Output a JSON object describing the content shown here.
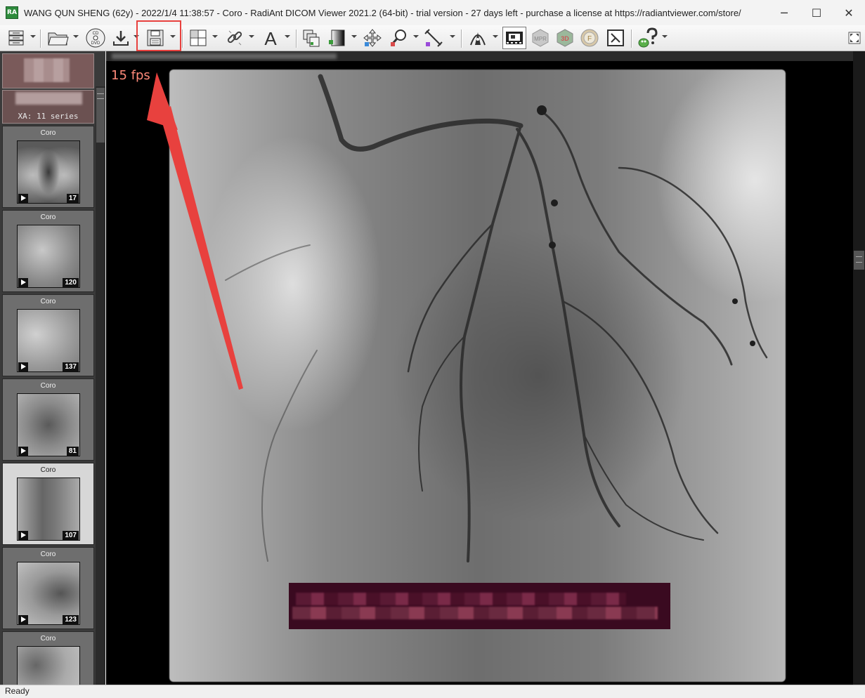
{
  "window": {
    "title": "WANG QUN SHENG (62y) - 2022/1/4 11:38:57 - Coro - RadiAnt DICOM Viewer 2021.2 (64-bit) - trial version - 27 days left - purchase a license at https://radiantviewer.com/store/",
    "app_icon": "RA",
    "buttons": {
      "minimize": "─",
      "maximize": "☐",
      "close": "✕"
    }
  },
  "toolbar": {
    "items": [
      {
        "name": "database-icon"
      },
      {
        "name": "open-folder-icon"
      },
      {
        "name": "cd-dvd-icon"
      },
      {
        "name": "download-icon"
      },
      {
        "name": "save-icon"
      },
      {
        "name": "layout-grid-icon"
      },
      {
        "name": "link-icon"
      },
      {
        "name": "annotation-text-icon"
      },
      {
        "name": "series-stack-icon"
      },
      {
        "name": "window-level-icon"
      },
      {
        "name": "pan-icon"
      },
      {
        "name": "zoom-icon"
      },
      {
        "name": "measure-icon"
      },
      {
        "name": "fusion-icon"
      },
      {
        "name": "cine-icon"
      },
      {
        "name": "mpr-icon"
      },
      {
        "name": "3d-icon"
      },
      {
        "name": "flip-icon"
      },
      {
        "name": "xray-icon"
      },
      {
        "name": "help-icon"
      },
      {
        "name": "fullscreen-icon"
      }
    ],
    "labels": {
      "cd": "CD",
      "dvd": "DVD",
      "text": "A",
      "mpr": "MPR",
      "3d": "3D",
      "flip": "F"
    }
  },
  "sidebar": {
    "study_label": "XA: 11 series",
    "series": [
      {
        "label": "Coro",
        "count": "17"
      },
      {
        "label": "Coro",
        "count": "120"
      },
      {
        "label": "Coro",
        "count": "137"
      },
      {
        "label": "Coro",
        "count": "81"
      },
      {
        "label": "Coro",
        "count": "107",
        "selected": true
      },
      {
        "label": "Coro",
        "count": "123"
      },
      {
        "label": "Coro",
        "count": ""
      }
    ]
  },
  "viewer": {
    "fps": "15 fps",
    "close": "✕"
  },
  "status": {
    "text": "Ready"
  },
  "colors": {
    "highlight": "#e8413e",
    "fps": "#ff8a7a",
    "redaction": "#3a0a20"
  }
}
